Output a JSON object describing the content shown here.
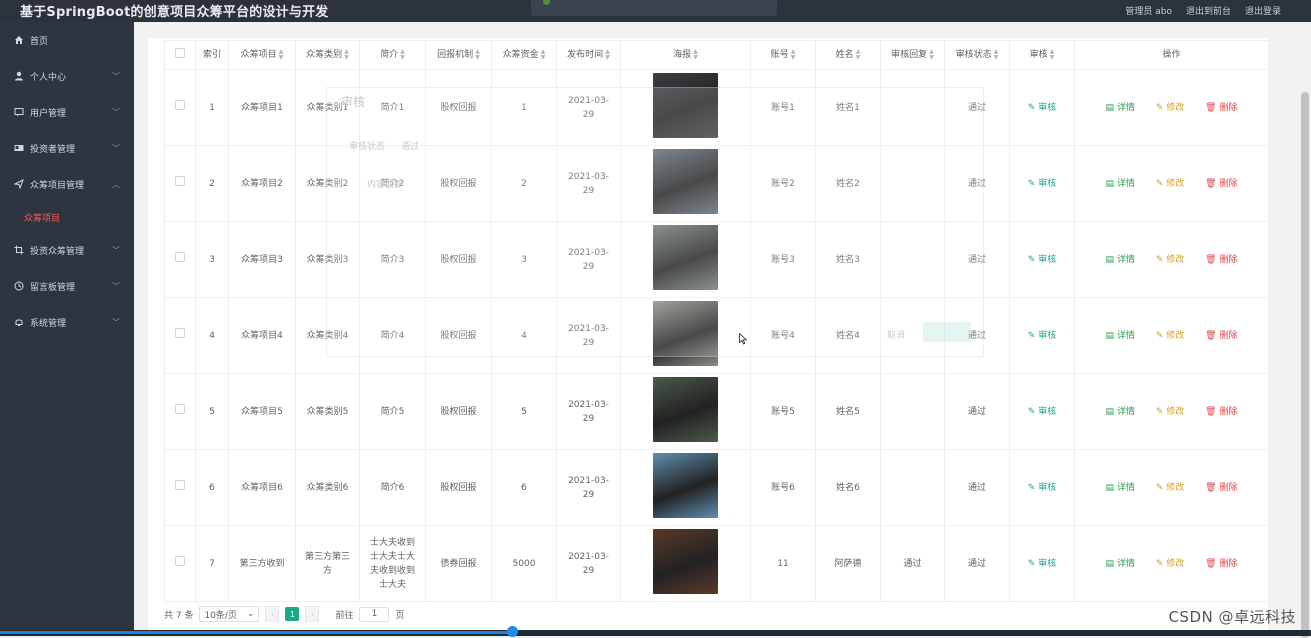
{
  "app": {
    "title": "基于SpringBoot的创意项目众筹平台的设计与开发"
  },
  "header": {
    "user": "管理员 abo",
    "front": "退出到前台",
    "logout": "退出登录"
  },
  "sidebar": {
    "items": [
      {
        "label": "首页",
        "icon": "home-icon"
      },
      {
        "label": "个人中心",
        "icon": "user-icon"
      },
      {
        "label": "用户管理",
        "icon": "chat-icon"
      },
      {
        "label": "投资者管理",
        "icon": "vcard-icon"
      },
      {
        "label": "众筹项目管理",
        "icon": "send-icon"
      },
      {
        "label": "投资众筹管理",
        "icon": "crop-icon"
      },
      {
        "label": "留言板管理",
        "icon": "clock-icon"
      },
      {
        "label": "系统管理",
        "icon": "bell-icon"
      }
    ],
    "sub_active": "众筹项目"
  },
  "table": {
    "headers": [
      "索引",
      "众筹项目",
      "众筹类别",
      "简介",
      "回报机制",
      "众筹资金",
      "发布时间",
      "海报",
      "账号",
      "姓名",
      "审核回复",
      "审核状态",
      "审核",
      "操作"
    ],
    "rows": [
      {
        "index": "1",
        "project": "众筹项目1",
        "category": "众筹类别1",
        "intro": "简介1",
        "reward": "股权回报",
        "funds": "1",
        "time": "2021-03-29",
        "account": "账号1",
        "name": "姓名1",
        "reply": "",
        "status": "通过"
      },
      {
        "index": "2",
        "project": "众筹项目2",
        "category": "众筹类别2",
        "intro": "简介2",
        "reward": "股权回报",
        "funds": "2",
        "time": "2021-03-29",
        "account": "账号2",
        "name": "姓名2",
        "reply": "",
        "status": "通过"
      },
      {
        "index": "3",
        "project": "众筹项目3",
        "category": "众筹类别3",
        "intro": "简介3",
        "reward": "股权回报",
        "funds": "3",
        "time": "2021-03-29",
        "account": "账号3",
        "name": "姓名3",
        "reply": "",
        "status": "通过"
      },
      {
        "index": "4",
        "project": "众筹项目4",
        "category": "众筹类别4",
        "intro": "简介4",
        "reward": "股权回报",
        "funds": "4",
        "time": "2021-03-29",
        "account": "账号4",
        "name": "姓名4",
        "reply": "",
        "status": "通过"
      },
      {
        "index": "5",
        "project": "众筹项目5",
        "category": "众筹类别5",
        "intro": "简介5",
        "reward": "股权回报",
        "funds": "5",
        "time": "2021-03-29",
        "account": "账号5",
        "name": "姓名5",
        "reply": "",
        "status": "通过"
      },
      {
        "index": "6",
        "project": "众筹项目6",
        "category": "众筹类别6",
        "intro": "简介6",
        "reward": "股权回报",
        "funds": "6",
        "time": "2021-03-29",
        "account": "账号6",
        "name": "姓名6",
        "reply": "",
        "status": "通过"
      },
      {
        "index": "7",
        "project": "第三方收到",
        "category": "第三方第三方",
        "intro": "士大夫收到士大夫士大夫收到收到士大夫",
        "reward": "债券回报",
        "funds": "5000",
        "time": "2021-03-29",
        "account": "11",
        "name": "阿萨德",
        "reply": "通过",
        "status": "通过"
      }
    ],
    "actions": {
      "review": "审核",
      "detail": "详情",
      "edit": "修改",
      "delete": "删除"
    },
    "poster_colors": [
      "#3d3f44",
      "#606b77",
      "#6e7a74",
      "#8a8f86",
      "#4a5a4a",
      "#5f8fb0",
      "#5a3a28"
    ]
  },
  "pagination": {
    "total": "共 7 条",
    "page_size": "10条/页",
    "current": "1",
    "goto": "前往",
    "goto_value": "1",
    "page_suffix": "页"
  },
  "dialog": {
    "title": "审核",
    "label": "审核状态",
    "status": "通过",
    "reply_label": "内容回复",
    "cancel": "取消"
  },
  "watermark": "CSDN @卓远科技"
}
